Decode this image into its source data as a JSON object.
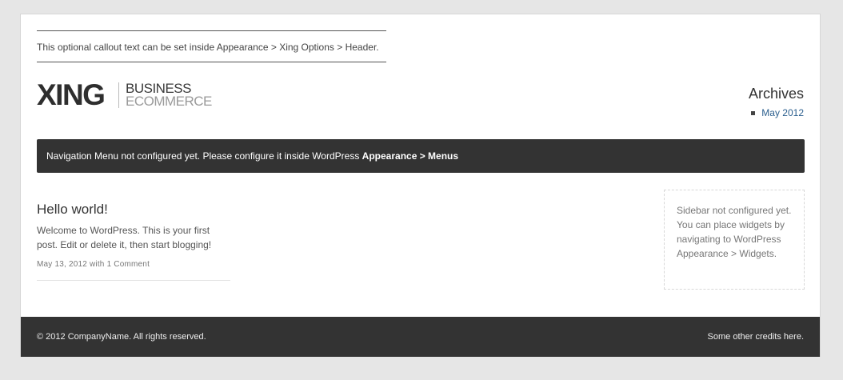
{
  "header": {
    "callout": "This optional callout text can be set inside Appearance > Xing Options > Header.",
    "logo": {
      "mark": "XING",
      "line1": "BUSINESS",
      "line2": "ECOMMERCE"
    }
  },
  "archives": {
    "title": "Archives",
    "items": [
      {
        "label": "May 2012"
      }
    ]
  },
  "navigation": {
    "message": "Navigation Menu not configured yet. Please configure it inside WordPress ",
    "path": "Appearance > Menus"
  },
  "post": {
    "title": "Hello world!",
    "body": "Welcome to WordPress. This is your first post. Edit or delete it, then start blogging!",
    "date": "May 13, 2012",
    "with": "with",
    "comments": "1 Comment"
  },
  "sidebar": {
    "message": "Sidebar not configured yet. You can place widgets by navigating to WordPress Appearance > Widgets."
  },
  "footer": {
    "copyright": "© 2012 CompanyName. All rights reserved.",
    "credits": "Some other credits here."
  },
  "colors": {
    "background": "#e6e6e6",
    "bar": "#333333",
    "link": "#2b5f8e"
  }
}
